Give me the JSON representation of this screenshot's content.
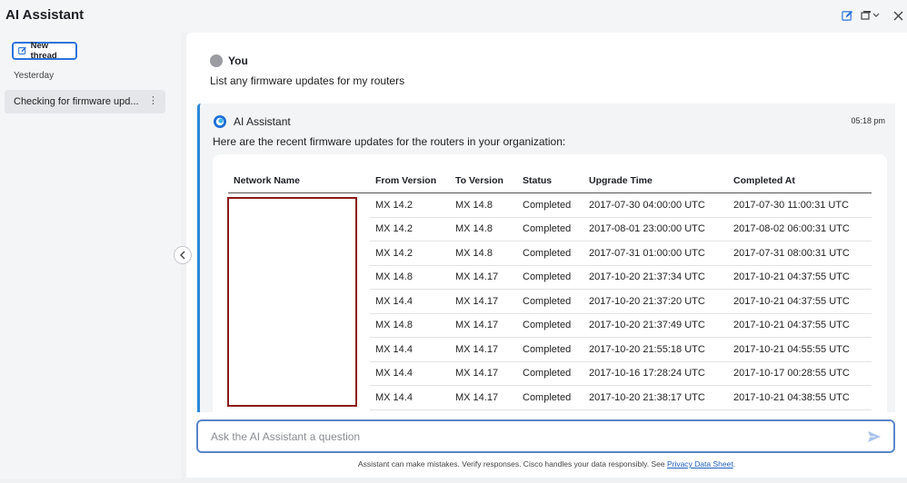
{
  "window": {
    "title": "AI Assistant",
    "icons": [
      "edit-icon",
      "window-menu-icon",
      "close-icon"
    ]
  },
  "sidebar": {
    "new_thread_label": "New thread",
    "section_label": "Yesterday",
    "threads": [
      {
        "label": "Checking for firmware upd..."
      }
    ]
  },
  "conversation": {
    "user": {
      "name": "You",
      "message": "List any firmware updates for my routers"
    },
    "assistant": {
      "name": "AI Assistant",
      "time": "05:18 pm",
      "intro": "Here are the recent firmware updates for the routers in your organization:",
      "table": {
        "headers": [
          "Network Name",
          "From Version",
          "To Version",
          "Status",
          "Upgrade Time",
          "Completed At"
        ],
        "rows": [
          [
            "",
            "MX 14.2",
            "MX 14.8",
            "Completed",
            "2017-07-30 04:00:00 UTC",
            "2017-07-30 11:00:31 UTC"
          ],
          [
            "",
            "MX 14.2",
            "MX 14.8",
            "Completed",
            "2017-08-01 23:00:00 UTC",
            "2017-08-02 06:00:31 UTC"
          ],
          [
            "",
            "MX 14.2",
            "MX 14.8",
            "Completed",
            "2017-07-31 01:00:00 UTC",
            "2017-07-31 08:00:31 UTC"
          ],
          [
            "",
            "MX 14.8",
            "MX 14.17",
            "Completed",
            "2017-10-20 21:37:34 UTC",
            "2017-10-21 04:37:55 UTC"
          ],
          [
            "",
            "MX 14.4",
            "MX 14.17",
            "Completed",
            "2017-10-20 21:37:20 UTC",
            "2017-10-21 04:37:55 UTC"
          ],
          [
            "",
            "MX 14.8",
            "MX 14.17",
            "Completed",
            "2017-10-20 21:37:49 UTC",
            "2017-10-21 04:37:55 UTC"
          ],
          [
            "",
            "MX 14.4",
            "MX 14.17",
            "Completed",
            "2017-10-20 21:55:18 UTC",
            "2017-10-21 04:55:55 UTC"
          ],
          [
            "",
            "MX 14.4",
            "MX 14.17",
            "Completed",
            "2017-10-16 17:28:24 UTC",
            "2017-10-17 00:28:55 UTC"
          ],
          [
            "",
            "MX 14.4",
            "MX 14.17",
            "Completed",
            "2017-10-20 21:38:17 UTC",
            "2017-10-21 04:38:55 UTC"
          ]
        ]
      }
    }
  },
  "composer": {
    "placeholder": "Ask the AI Assistant a question",
    "value": ""
  },
  "footer": {
    "disclaimer": "Assistant can make mistakes. Verify responses. Cisco handles your data responsibly. See ",
    "link_text": "Privacy Data Sheet",
    "suffix": "."
  },
  "colors": {
    "accent": "#2d74da",
    "ai_border": "#2d88d8",
    "redaction": "#8b1a1a"
  }
}
